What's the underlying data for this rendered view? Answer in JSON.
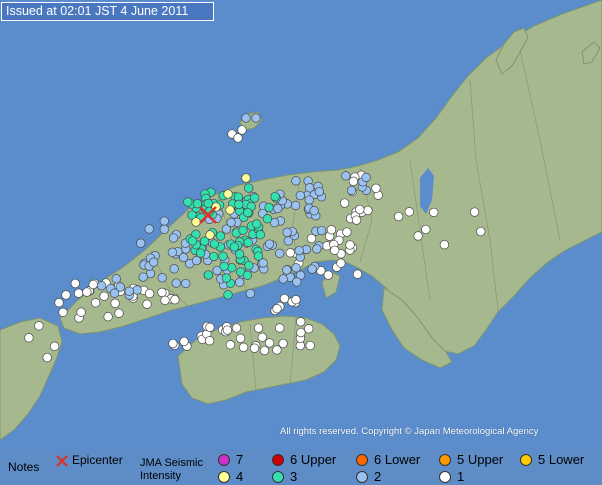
{
  "issued": "Issued at 02:01 JST  4 June 2011",
  "credit": "All rights reserved. Copyright © Japan Meteorological Agency",
  "colors": {
    "sea": "#5b8ccb",
    "land": "#a6b98e",
    "land_edge": "#7f9570",
    "epicenter": "#e0302a"
  },
  "legend": {
    "notes": "Notes",
    "epicenter": "Epicenter",
    "scale_line1": "JMA Seismic",
    "scale_line2": "Intensity",
    "items": [
      {
        "label": "7",
        "color": "#cc33cc"
      },
      {
        "label": "6 Upper",
        "color": "#cc0000"
      },
      {
        "label": "6 Lower",
        "color": "#ff6600"
      },
      {
        "label": "5 Upper",
        "color": "#ff9900"
      },
      {
        "label": "5 Lower",
        "color": "#ffcc00"
      },
      {
        "label": "4",
        "color": "#ffff99"
      },
      {
        "label": "3",
        "color": "#33e0b0"
      },
      {
        "label": "2",
        "color": "#99c2f0"
      },
      {
        "label": "1",
        "color": "#ffffff"
      }
    ]
  }
}
